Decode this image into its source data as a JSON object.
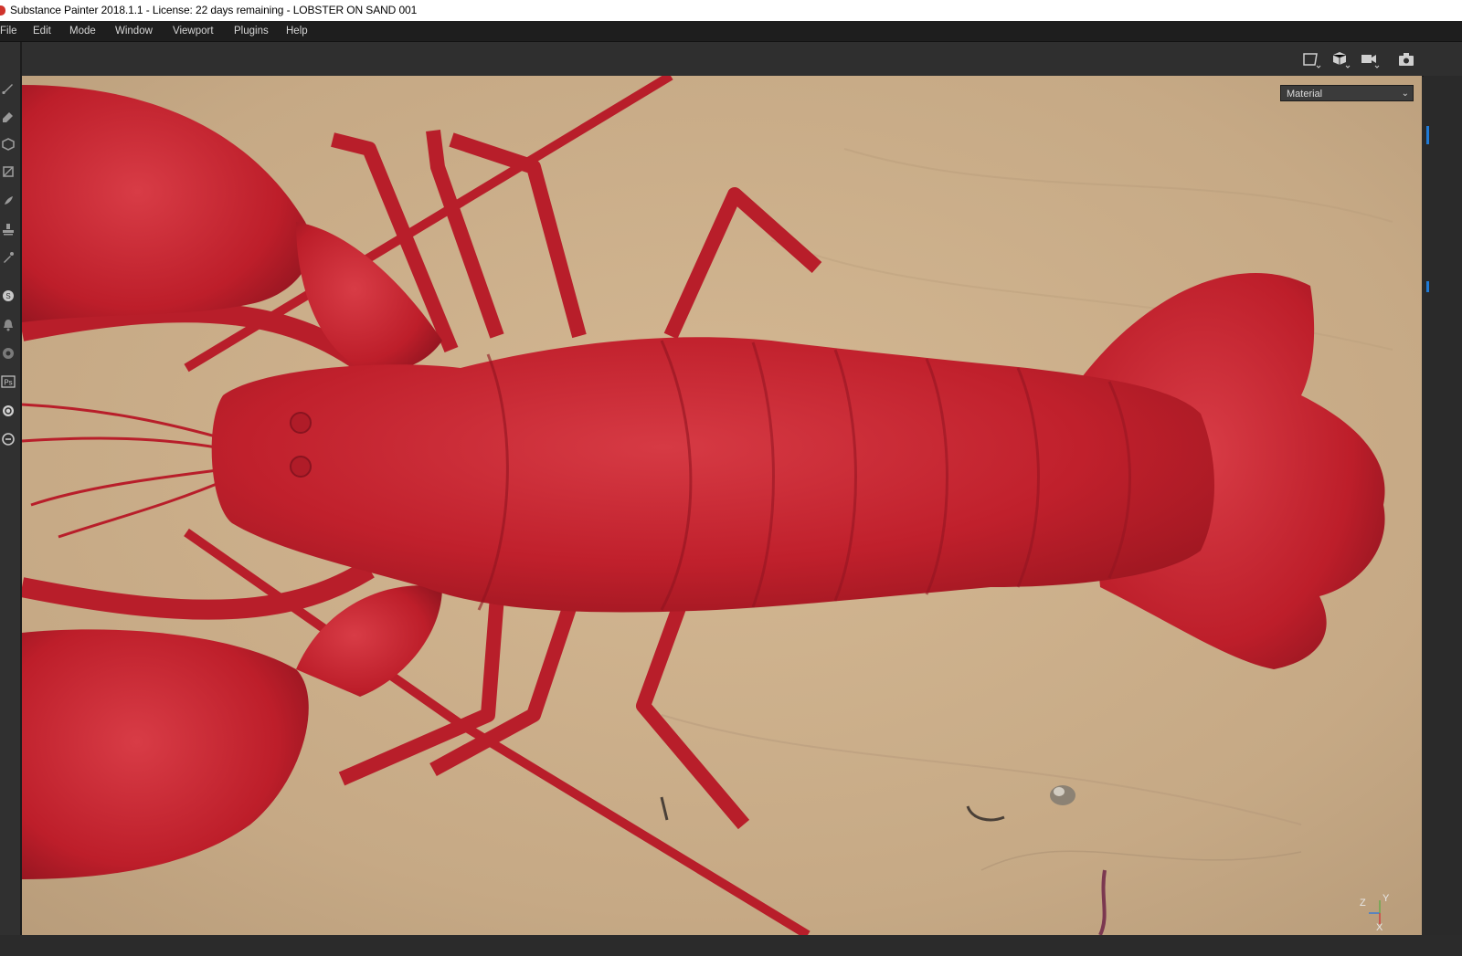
{
  "window": {
    "title": "Substance Painter 2018.1.1 - License: 22 days remaining - LOBSTER ON SAND 001"
  },
  "menu": {
    "items": [
      "File",
      "Edit",
      "Mode",
      "Window",
      "Viewport",
      "Plugins",
      "Help"
    ]
  },
  "toolbar": {
    "icons": [
      "2d-view-icon",
      "3d-view-icon",
      "camera-icon",
      "screenshot-icon"
    ]
  },
  "left_tools": [
    "paint-brush-icon",
    "eraser-icon",
    "projection-icon",
    "polygon-fill-icon",
    "smudge-icon",
    "clone-stamp-icon",
    "color-picker-icon",
    "substance-icon",
    "bell-icon",
    "substance-share-icon",
    "photoshop-icon",
    "search-icon",
    "settings-icon"
  ],
  "left_tools_text": {
    "ps": "Ps"
  },
  "viewport": {
    "material_select": {
      "value": "Material"
    },
    "axes": {
      "z": "Z",
      "y": "Y",
      "x": "X"
    }
  },
  "colors": {
    "lobster": "#c0202c",
    "sand": "#c9ad8a",
    "panel": "#2f2f2f",
    "accent": "#1f7ad6"
  }
}
